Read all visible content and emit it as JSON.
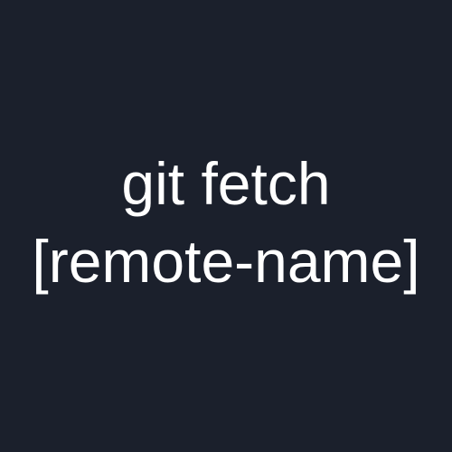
{
  "content": {
    "line1": "git fetch",
    "line2": "[remote-name]"
  },
  "colors": {
    "background": "#1b202c",
    "text": "#ffffff"
  }
}
